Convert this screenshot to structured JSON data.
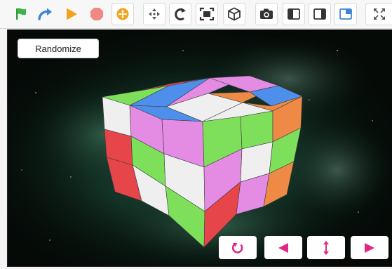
{
  "toolbar": {
    "buttons": [
      {
        "icon": "green-flag-icon",
        "color": "#2e9b3a"
      },
      {
        "icon": "redo-arrow-icon",
        "color": "#3d83d6"
      },
      {
        "icon": "play-icon",
        "color": "#f3a21c"
      },
      {
        "icon": "stop-icon",
        "color": "#ef8a83"
      },
      {
        "icon": "orbit-target-icon",
        "color": "#f3a21c"
      },
      {
        "icon": "move-arrows-icon",
        "color": "#555555"
      },
      {
        "icon": "rotate-icon",
        "color": "#333333"
      },
      {
        "icon": "fit-frame-icon",
        "color": "#333333"
      },
      {
        "icon": "cube-icon",
        "color": "#333333"
      },
      {
        "icon": "camera-icon",
        "color": "#333333"
      },
      {
        "icon": "layout-left-panel-icon",
        "color": "#333333"
      },
      {
        "icon": "layout-right-panel-icon",
        "color": "#333333"
      },
      {
        "icon": "layout-corner-panel-icon",
        "color": "#3d83d6"
      },
      {
        "icon": "fullscreen-icon",
        "color": "#555555"
      }
    ]
  },
  "viewport": {
    "randomize_label": "Randomize",
    "nav_buttons": [
      {
        "icon": "reset-rotate-icon",
        "color": "#e0288a"
      },
      {
        "icon": "left-arrow-icon",
        "color": "#e0288a"
      },
      {
        "icon": "vertical-arrows-icon",
        "color": "#e0288a"
      },
      {
        "icon": "right-arrow-icon",
        "color": "#e0288a"
      }
    ],
    "cube_colors": {
      "white": "#efefef",
      "green": "#7ee05a",
      "red": "#e64549",
      "pink": "#e48be4",
      "blue": "#4d8fea",
      "orange": "#ee8a45"
    }
  }
}
